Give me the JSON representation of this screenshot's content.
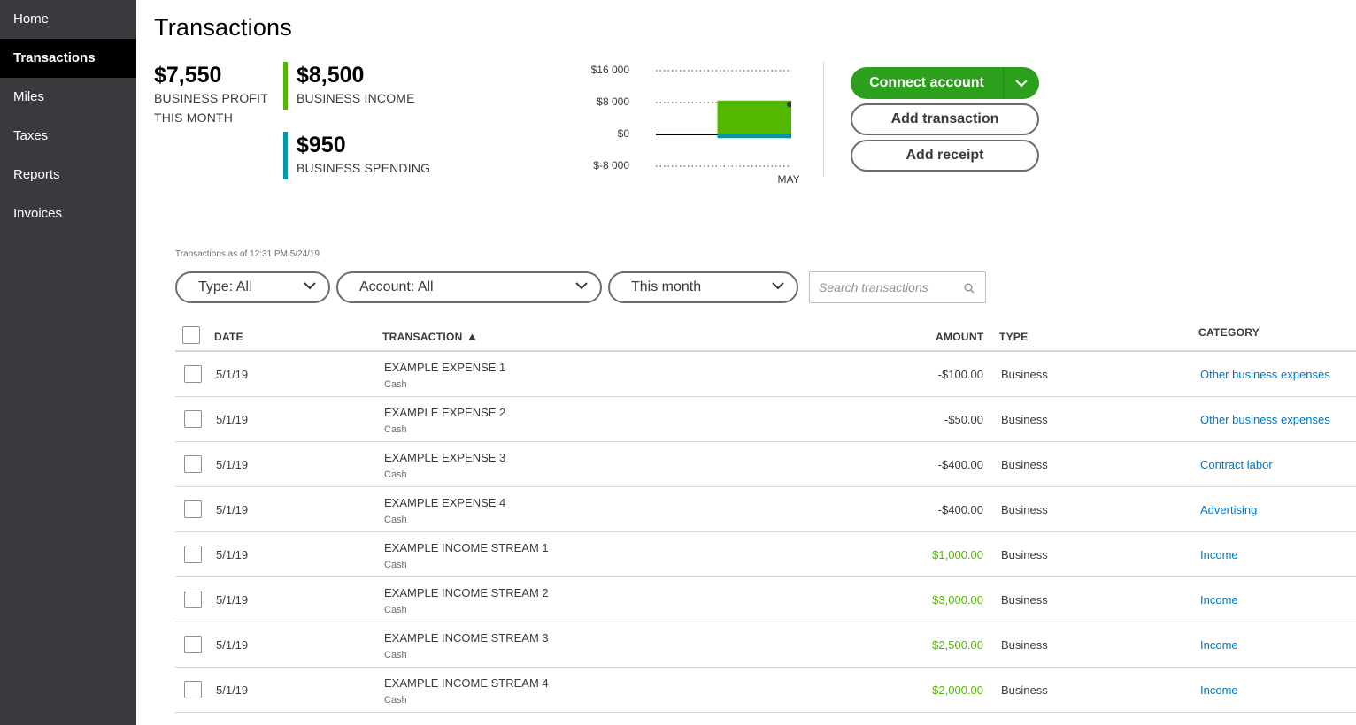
{
  "sidebar": {
    "items": [
      {
        "label": "Home"
      },
      {
        "label": "Transactions"
      },
      {
        "label": "Miles"
      },
      {
        "label": "Taxes"
      },
      {
        "label": "Reports"
      },
      {
        "label": "Invoices"
      }
    ]
  },
  "header": {
    "title": "Transactions"
  },
  "summary": {
    "profit": {
      "value": "$7,550",
      "label": "BUSINESS PROFIT THIS MONTH"
    },
    "income": {
      "value": "$8,500",
      "label": "BUSINESS INCOME",
      "color": "#53b700"
    },
    "spending": {
      "value": "$950",
      "label": "BUSINESS SPENDING",
      "color": "#0097a7"
    }
  },
  "chart_data": {
    "type": "bar",
    "categories": [
      "MAY"
    ],
    "series": [
      {
        "values": [
          8500
        ],
        "color": "#53b700"
      },
      {
        "values": [
          -950
        ],
        "color": "#0097a7"
      }
    ],
    "profit_marker": [
      7550
    ],
    "yticks": [
      16000,
      8000,
      0,
      -8000
    ],
    "ytick_labels": [
      "$16 000",
      "$8 000",
      "$0",
      "$-8 000"
    ],
    "ylim": [
      -8000,
      16000
    ]
  },
  "actions": {
    "connect_label": "Connect account",
    "add_transaction_label": "Add transaction",
    "add_receipt_label": "Add receipt"
  },
  "as_of": "Transactions as of 12:31 PM 5/24/19",
  "filters": {
    "type": "Type: All",
    "account": "Account: All",
    "period": "This month",
    "search_placeholder": "Search transactions"
  },
  "table": {
    "columns": {
      "date": "DATE",
      "transaction": "TRANSACTION",
      "amount": "AMOUNT",
      "type": "TYPE",
      "category": "CATEGORY"
    },
    "rows": [
      {
        "date": "5/1/19",
        "name": "EXAMPLE EXPENSE 1",
        "account": "Cash",
        "amount": "-$100.00",
        "positive": false,
        "type": "Business",
        "category": "Other business expenses"
      },
      {
        "date": "5/1/19",
        "name": "EXAMPLE EXPENSE 2",
        "account": "Cash",
        "amount": "-$50.00",
        "positive": false,
        "type": "Business",
        "category": "Other business expenses"
      },
      {
        "date": "5/1/19",
        "name": "EXAMPLE EXPENSE 3",
        "account": "Cash",
        "amount": "-$400.00",
        "positive": false,
        "type": "Business",
        "category": "Contract labor"
      },
      {
        "date": "5/1/19",
        "name": "EXAMPLE EXPENSE 4",
        "account": "Cash",
        "amount": "-$400.00",
        "positive": false,
        "type": "Business",
        "category": "Advertising"
      },
      {
        "date": "5/1/19",
        "name": "EXAMPLE INCOME STREAM 1",
        "account": "Cash",
        "amount": "$1,000.00",
        "positive": true,
        "type": "Business",
        "category": "Income"
      },
      {
        "date": "5/1/19",
        "name": "EXAMPLE INCOME STREAM 2",
        "account": "Cash",
        "amount": "$3,000.00",
        "positive": true,
        "type": "Business",
        "category": "Income"
      },
      {
        "date": "5/1/19",
        "name": "EXAMPLE INCOME STREAM 3",
        "account": "Cash",
        "amount": "$2,500.00",
        "positive": true,
        "type": "Business",
        "category": "Income"
      },
      {
        "date": "5/1/19",
        "name": "EXAMPLE INCOME STREAM 4",
        "account": "Cash",
        "amount": "$2,000.00",
        "positive": true,
        "type": "Business",
        "category": "Income"
      }
    ]
  }
}
